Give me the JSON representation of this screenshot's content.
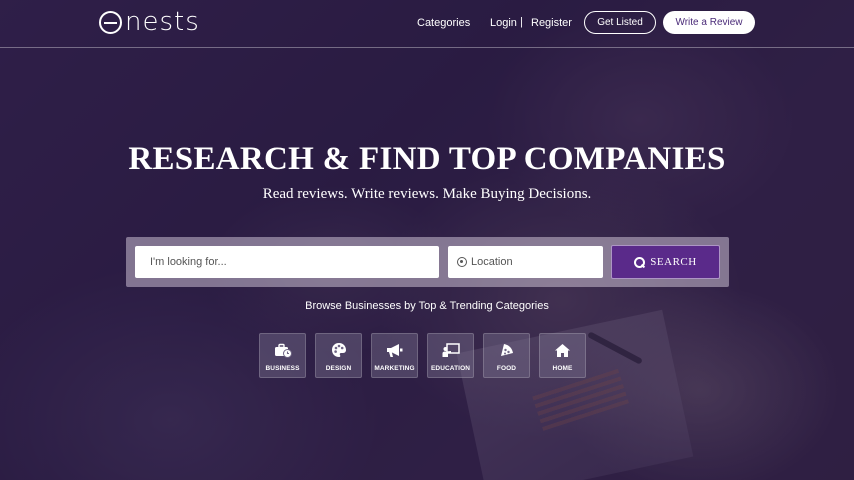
{
  "header": {
    "logo_text": "nests",
    "nav": {
      "categories": "Categories",
      "login": "Login",
      "separator": "|",
      "register": "Register"
    },
    "get_listed": "Get Listed",
    "write_review": "Write a Review"
  },
  "hero": {
    "title": "RESEARCH & FIND TOP COMPANIES",
    "subtitle": "Read reviews. Write reviews. Make Buying Decisions."
  },
  "search": {
    "keyword_placeholder": "I'm looking for...",
    "location_placeholder": "Location",
    "button_label": "SEARCH"
  },
  "browse_text": "Browse Businesses by Top & Trending Categories",
  "categories": [
    {
      "label": "BUSINESS",
      "icon": "briefcase-clock-icon"
    },
    {
      "label": "DESIGN",
      "icon": "palette-icon"
    },
    {
      "label": "MARKETING",
      "icon": "megaphone-icon"
    },
    {
      "label": "EDUCATION",
      "icon": "teacher-board-icon"
    },
    {
      "label": "FOOD",
      "icon": "pizza-slice-icon"
    },
    {
      "label": "HOME",
      "icon": "house-icon"
    }
  ],
  "colors": {
    "brand_purple": "#5a2a8a",
    "overlay": "#26163e",
    "review_button_text": "#4a2a78"
  }
}
